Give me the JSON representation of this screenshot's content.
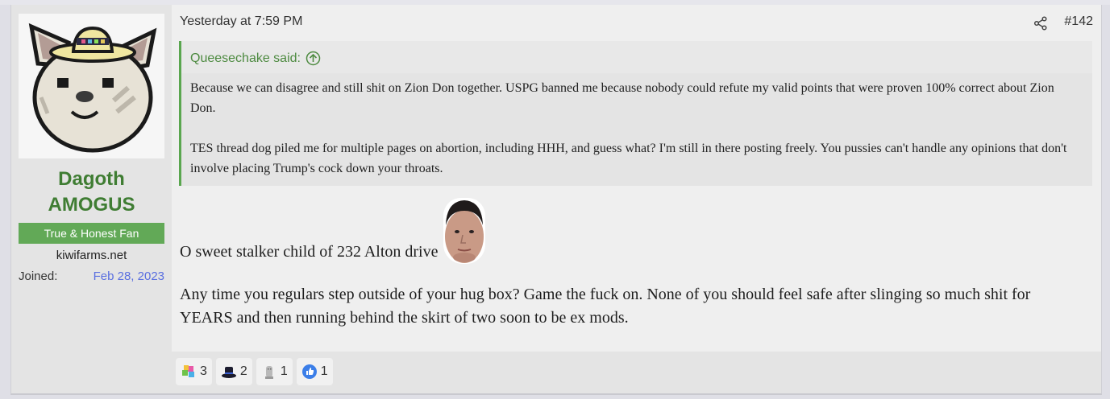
{
  "user": {
    "name_line1": "Dagoth",
    "name_line2": "AMOGUS",
    "title": "True & Honest Fan",
    "site": "kiwifarms.net",
    "joined_label": "Joined:",
    "joined_value": "Feb 28, 2023"
  },
  "post": {
    "date": "Yesterday at 7:59 PM",
    "number": "#142"
  },
  "quote": {
    "author": "Queesechake said:",
    "paragraphs": [
      "Because we can disagree and still shit on Zion Don together. USPG banned me because nobody could refute my valid points that were proven 100% correct about Zion Don.",
      "TES thread dog piled me for multiple pages on abortion, including HHH, and guess what? I'm still in there posting freely. You pussies can't handle any opinions that don't involve placing Trump's cock down your throats."
    ]
  },
  "body": {
    "line1": "O sweet stalker child of 232 Alton drive",
    "para2": "Any time you regulars step outside of your hug box? Game the fuck on. None of you should feel safe after slinging so much shit for YEARS and then running behind the skirt of two soon to be ex mods."
  },
  "reactions": [
    {
      "icon": "puzzle-icon",
      "count": "3"
    },
    {
      "icon": "top-hat-icon",
      "count": "2"
    },
    {
      "icon": "statue-icon",
      "count": "1"
    },
    {
      "icon": "thumbs-up-icon",
      "count": "1"
    }
  ],
  "colors": {
    "accent_green": "#3f7d33",
    "title_badge": "#62a957",
    "joined_link": "#5a6fe0"
  }
}
